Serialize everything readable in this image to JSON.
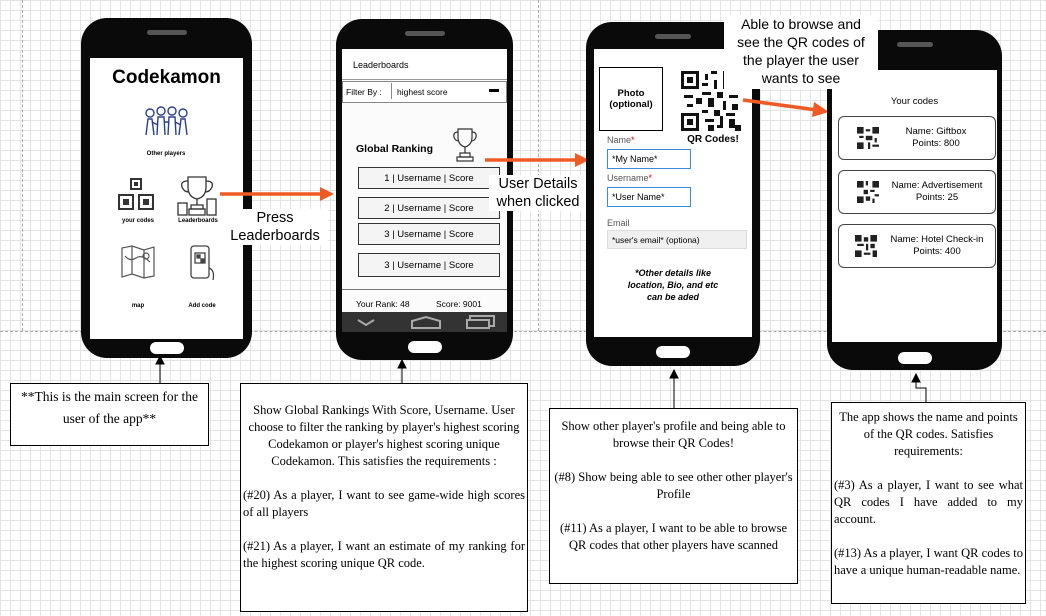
{
  "phone1": {
    "app_title": "Codekamon",
    "other_players": "Other players",
    "your_codes": "your codes",
    "leaderboards": "Leaderboards",
    "map": "map",
    "add_code": "Add code"
  },
  "arrow1_label": "Press\nLeaderboards",
  "phone2": {
    "header": "Leaderboards",
    "filter_label": "Filter By :",
    "filter_value": "highest score",
    "global_ranking": "Global Ranking",
    "rows": [
      "1 | Username | Score",
      "2 | Username | Score",
      "3 | Username | Score",
      "3 | Username | Score"
    ],
    "your_rank": "Your Rank: 48",
    "score": "Score: 9001"
  },
  "arrow2_label": "User Details\nwhen clicked",
  "phone3": {
    "photo": "Photo\n(optional)",
    "qr_codes": "QR Codes!",
    "name_label": "Name",
    "name_value": "*My Name*",
    "username_label": "Username",
    "username_value": "*User Name*",
    "email_label": "Email",
    "email_value": "*user's email* (optiona)",
    "other_details": "*Other details like\nlocation, Bio, and etc\ncan be aded"
  },
  "arrow3_label": "Able to browse and\nsee the QR codes of\nthe player the user\nwants to see",
  "phone4": {
    "header": "Your codes",
    "codes": [
      {
        "name": "Name: Giftbox",
        "points": "Points: 800"
      },
      {
        "name": "Name: Advertisement",
        "points": "Points: 25"
      },
      {
        "name": "Name: Hotel Check-in",
        "points": "Points: 400"
      }
    ]
  },
  "notes": {
    "n1": "**This is the main screen for the user of the app**",
    "n2_intro": "Show Global Rankings With Score, Username. User choose to  filter the ranking by player's highest scoring Codekamon or player's highest scoring unique Codekamon. This satisfies the requirements :",
    "n2_req1": "(#20) As a player, I want to see game-wide high scores of all players",
    "n2_req2": "(#21) As a player, I want an estimate of my ranking for the highest scoring unique QR code.",
    "n3_intro": "Show other player's profile and being able to browse their QR Codes!",
    "n3_req1": "(#8) Show being able to see other other player's Profile",
    "n3_req2": "(#11) As a player, I want to be able to browse QR codes that other players have scanned",
    "n4_intro": "The app shows the name and points of the QR codes. Satisfies requirements:",
    "n4_req1": "(#3)  As a player, I want to see what QR codes I have added to my account.",
    "n4_req2": "(#13)  As a player, I want QR codes to have a unique human-readable name."
  }
}
